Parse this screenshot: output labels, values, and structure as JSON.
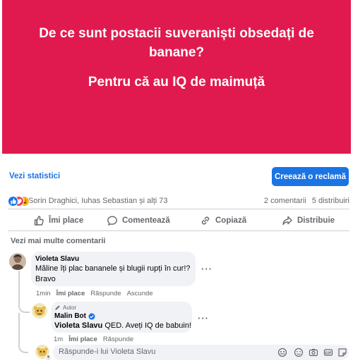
{
  "banner": {
    "line1": "De ce sunt postacii suveraniști obsedați de",
    "line2": "banane?",
    "line3": "Pentru că au IQ de maimuță",
    "color": "#e01a4f"
  },
  "stats": {
    "link_label": "Vezi statistici",
    "ad_button_label": "Creează o reclamă"
  },
  "reactions": {
    "icons": [
      "like-icon",
      "love-icon",
      "haha-icon"
    ],
    "names": "Sorin Draghici, Iuhas Sebastian și alți 73",
    "comments": "2 comentarii",
    "shares": "5 distribuiri"
  },
  "actions": {
    "like": "Îmi place",
    "comment": "Comentează",
    "copy": "Copiază",
    "share": "Distribuie"
  },
  "more_comments": "Vezi mai multe comentarii",
  "comment1": {
    "author": "Violeta Slavu",
    "text1": "Măline îți plac bananele și blugii rupți în cur!?",
    "text2": "Bravo",
    "time": "1min",
    "like": "Îmi place",
    "reply": "Răspunde",
    "hide": "Ascunde"
  },
  "reply1": {
    "badge": "Autor",
    "author": "Malin Bot",
    "mention": "Violeta Slavu",
    "text": " QED. Aveți IQ de babuin!",
    "time": "1m",
    "like": "Îmi place",
    "reply": "Răspunde"
  },
  "reply_box": {
    "placeholder": "Răspunde-i lui Violeta Slavu"
  }
}
